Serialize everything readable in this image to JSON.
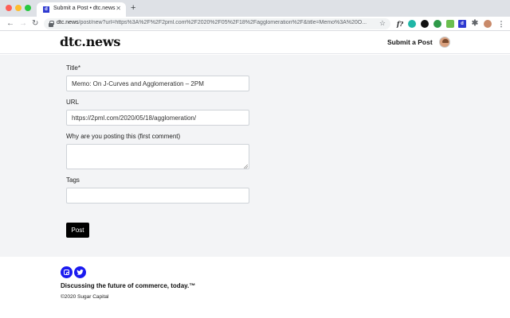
{
  "browser": {
    "tab": {
      "title": "Submit a Post • dtc.news",
      "favicon": "d",
      "close_icon": "✕"
    },
    "new_tab_icon": "+",
    "nav": {
      "back": "←",
      "forward": "→",
      "reload": "↻"
    },
    "url": {
      "host": "dtc.news",
      "rest": "/post/new?url=https%3A%2F%2F2pml.com%2F2020%2F05%2F18%2Fagglomeration%2F&title=Memo%3A%20O..."
    },
    "bookmark_icon": "☆",
    "extensions": {
      "f_label": "f?",
      "d_label": "d",
      "menu_icon": "⋮",
      "puzzle_icon": "✱"
    }
  },
  "site": {
    "logo": "dtc.news",
    "submit_link": "Submit a Post"
  },
  "form": {
    "title_label": "Title*",
    "title_value": "Memo: On J-Curves and Agglomeration – 2PM",
    "url_label": "URL",
    "url_value": "https://2pml.com/2020/05/18/agglomeration/",
    "comment_label": "Why are you posting this (first comment)",
    "comment_value": "",
    "tags_label": "Tags",
    "tags_value": "",
    "post_button": "Post"
  },
  "footer": {
    "tagline": "Discussing the future of commerce, today.™",
    "copyright": "©2020 Sugar Capital"
  },
  "colors": {
    "accent_social": "#1a1af0",
    "page_bg": "#f3f4f6",
    "button_bg": "#000000"
  }
}
